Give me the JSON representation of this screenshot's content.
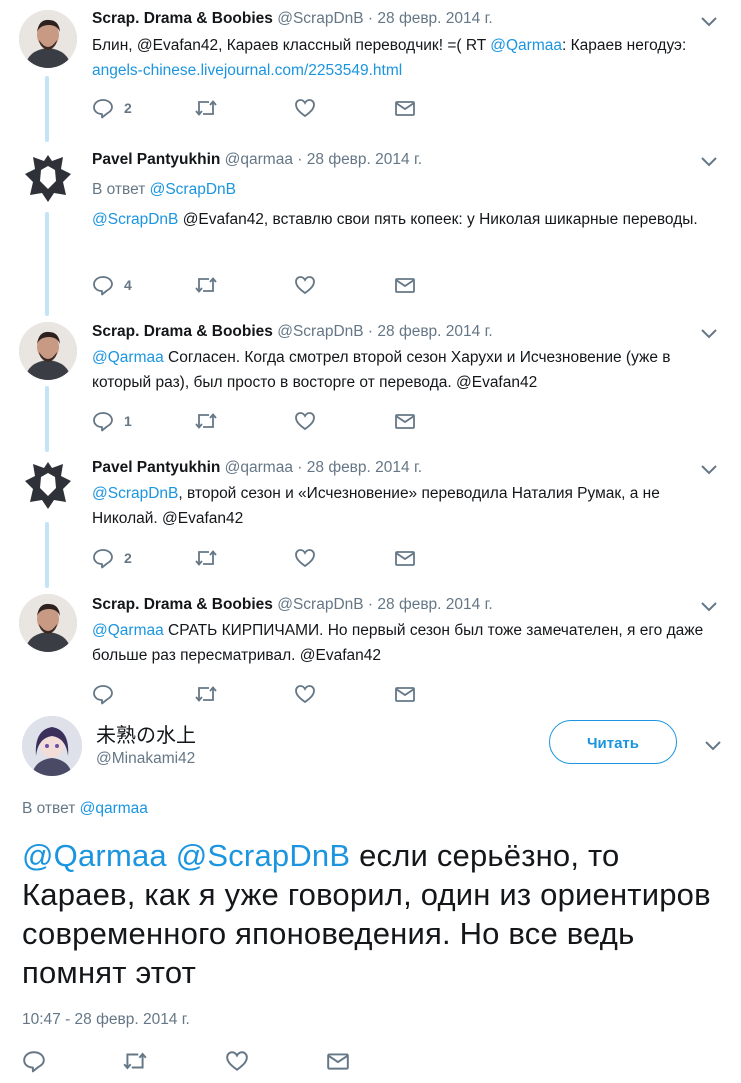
{
  "tweets": [
    {
      "name": "Scrap. Drama & Boobies",
      "handle": "@ScrapDnB",
      "date": "28 февр. 2014 г.",
      "reply_to": "",
      "parts": [
        {
          "t": "Блин, @Evafan42, Караев классный переводчик! =( RT ",
          "link": false
        },
        {
          "t": "@Qarmaa",
          "link": true
        },
        {
          "t": ": Караев негодуэ: ",
          "link": false
        },
        {
          "t": "angels-chinese.livejournal.com/2253549.html",
          "link": true
        }
      ],
      "reply_count": "2"
    },
    {
      "name": "Pavel Pantyukhin",
      "handle": "@qarmaa",
      "date": "28 февр. 2014 г.",
      "reply_to": "@ScrapDnB",
      "parts": [
        {
          "t": "@ScrapDnB",
          "link": true
        },
        {
          "t": " @Evafan42, вставлю свои пять копеек: у Николая шикарные переводы.",
          "link": false
        }
      ],
      "reply_count": "4"
    },
    {
      "name": "Scrap. Drama & Boobies",
      "handle": "@ScrapDnB",
      "date": "28 февр. 2014 г.",
      "reply_to": "",
      "parts": [
        {
          "t": "@Qarmaa",
          "link": true
        },
        {
          "t": " Согласен. Когда смотрел второй сезон Харухи и Исчезновение (уже в который раз), был просто в восторге от перевода. @Evafan42",
          "link": false
        }
      ],
      "reply_count": "1"
    },
    {
      "name": "Pavel Pantyukhin",
      "handle": "@qarmaa",
      "date": "28 февр. 2014 г.",
      "reply_to": "",
      "parts": [
        {
          "t": "@ScrapDnB",
          "link": true
        },
        {
          "t": ", второй сезон и «Исчезновение» переводила Наталия Румак, а не Николай.  @Evafan42",
          "link": false
        }
      ],
      "reply_count": "2"
    },
    {
      "name": "Scrap. Drama & Boobies",
      "handle": "@ScrapDnB",
      "date": "28 февр. 2014 г.",
      "reply_to": "",
      "parts": [
        {
          "t": "@Qarmaa",
          "link": true
        },
        {
          "t": " СРАТЬ КИРПИЧАМИ. Но первый сезон был тоже замечателен, я его даже больше раз пересматривал. @Evafan42",
          "link": false
        }
      ],
      "reply_count": ""
    }
  ],
  "labels": {
    "reply_prefix": "В ответ",
    "dot": "·"
  },
  "main": {
    "name": "未熟の水上",
    "handle": "@Minakami42",
    "follow_label": "Читать",
    "reply_prefix": "В ответ",
    "reply_to": "@qarmaa",
    "mention1": "@Qarmaa",
    "mention2": "@ScrapDnB",
    "text": " если серьёзно, то Караев, как я уже говорил, один из ориентиров современного японоведения. Но все ведь помнят этот",
    "timestamp": "10:47 - 28 февр. 2014 г."
  },
  "colors": {
    "link": "#1b95e0",
    "muted": "#657786",
    "thread_line": "#c4e4f6"
  },
  "icons": {
    "reply": "reply-icon",
    "retweet": "retweet-icon",
    "like": "heart-icon",
    "dm": "envelope-icon",
    "more": "chevron-down-icon"
  }
}
